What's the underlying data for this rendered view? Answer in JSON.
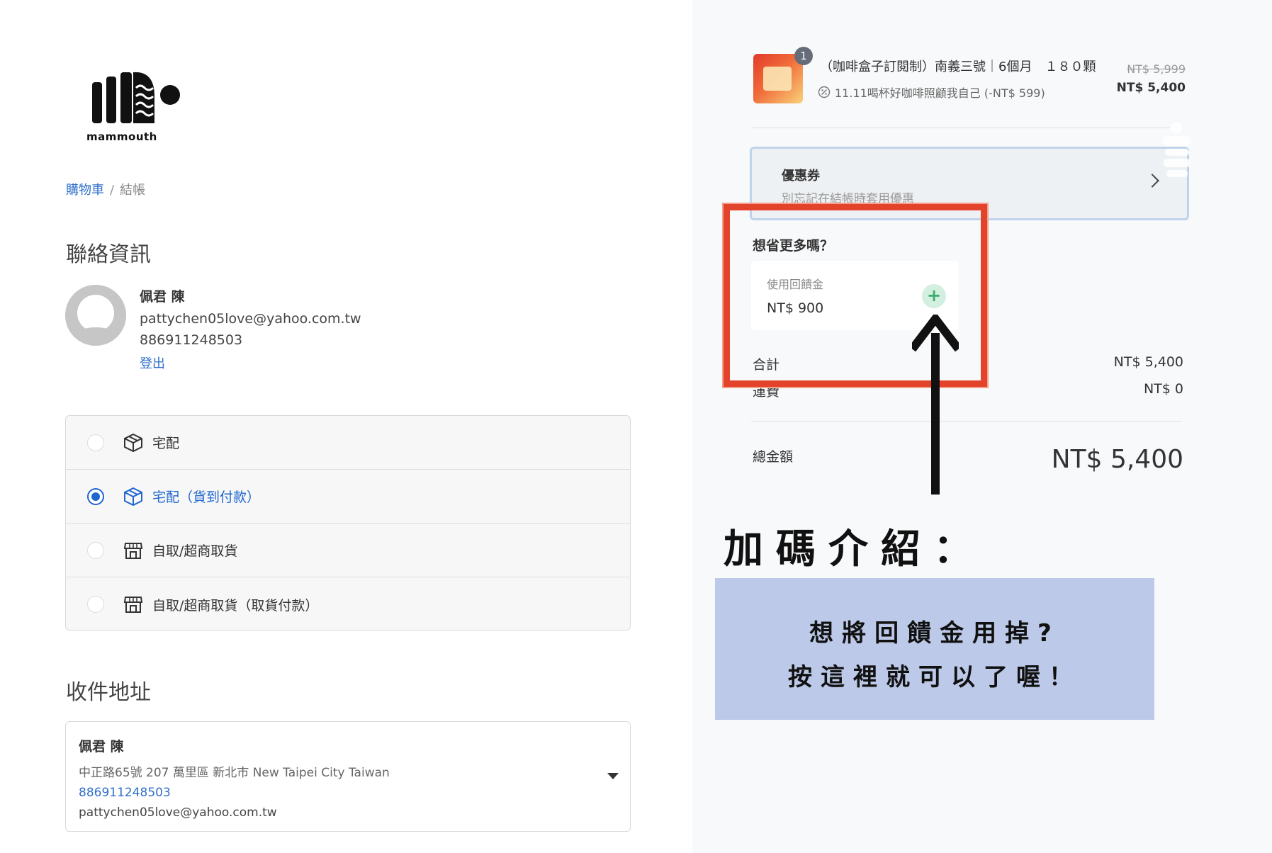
{
  "brand": {
    "logo_text": "mammouth"
  },
  "breadcrumb": {
    "cart": "購物車",
    "separator": "/",
    "current": "結帳"
  },
  "contact": {
    "section_title": "聯絡資訊",
    "name": "佩君 陳",
    "email": "pattychen05love@yahoo.com.tw",
    "phone": "886911248503",
    "logout": "登出"
  },
  "shipping": {
    "options": [
      {
        "label": "宅配",
        "icon": "box-icon",
        "selected": false
      },
      {
        "label": "宅配（貨到付款）",
        "icon": "box-icon",
        "selected": true
      },
      {
        "label": "自取/超商取貨",
        "icon": "store-icon",
        "selected": false
      },
      {
        "label": "自取/超商取貨（取貨付款）",
        "icon": "store-icon",
        "selected": false
      }
    ]
  },
  "address": {
    "section_title": "收件地址",
    "name": "佩君 陳",
    "line": "中正路65號 207 萬里區 新北市 New Taipei City Taiwan",
    "phone": "886911248503",
    "email": "pattychen05love@yahoo.com.tw"
  },
  "order": {
    "item": {
      "quantity": "1",
      "title": "（咖啡盒子訂閱制）南義三號｜6個月　１８０顆",
      "discount": "11.11喝杯好咖啡照顧我自己 (-NT$ 599)",
      "price_original": "NT$ 5,999",
      "price_final": "NT$ 5,400"
    },
    "coupon": {
      "title": "優惠券",
      "subtitle": "別忘記在結帳時套用優惠"
    },
    "rewards": {
      "title": "想省更多嗎？",
      "label": "使用回饋金",
      "amount": "NT$ 900",
      "add_symbol": "+"
    },
    "subtotal": {
      "label": "合計",
      "value": "NT$ 5,400"
    },
    "shipping_fee": {
      "label": "運費",
      "value": "NT$ 0"
    },
    "total": {
      "label": "總金額",
      "value": "NT$ 5,400"
    }
  },
  "annotation": {
    "heading": "加碼介紹：",
    "line1": "想將回饋金用掉?",
    "line2": "按這裡就可以了喔！"
  },
  "colors": {
    "link_blue": "#2f6fc9",
    "highlight_red": "#e3432a",
    "info_box": "#bcc9e8",
    "plus_green": "#3dab6c"
  }
}
